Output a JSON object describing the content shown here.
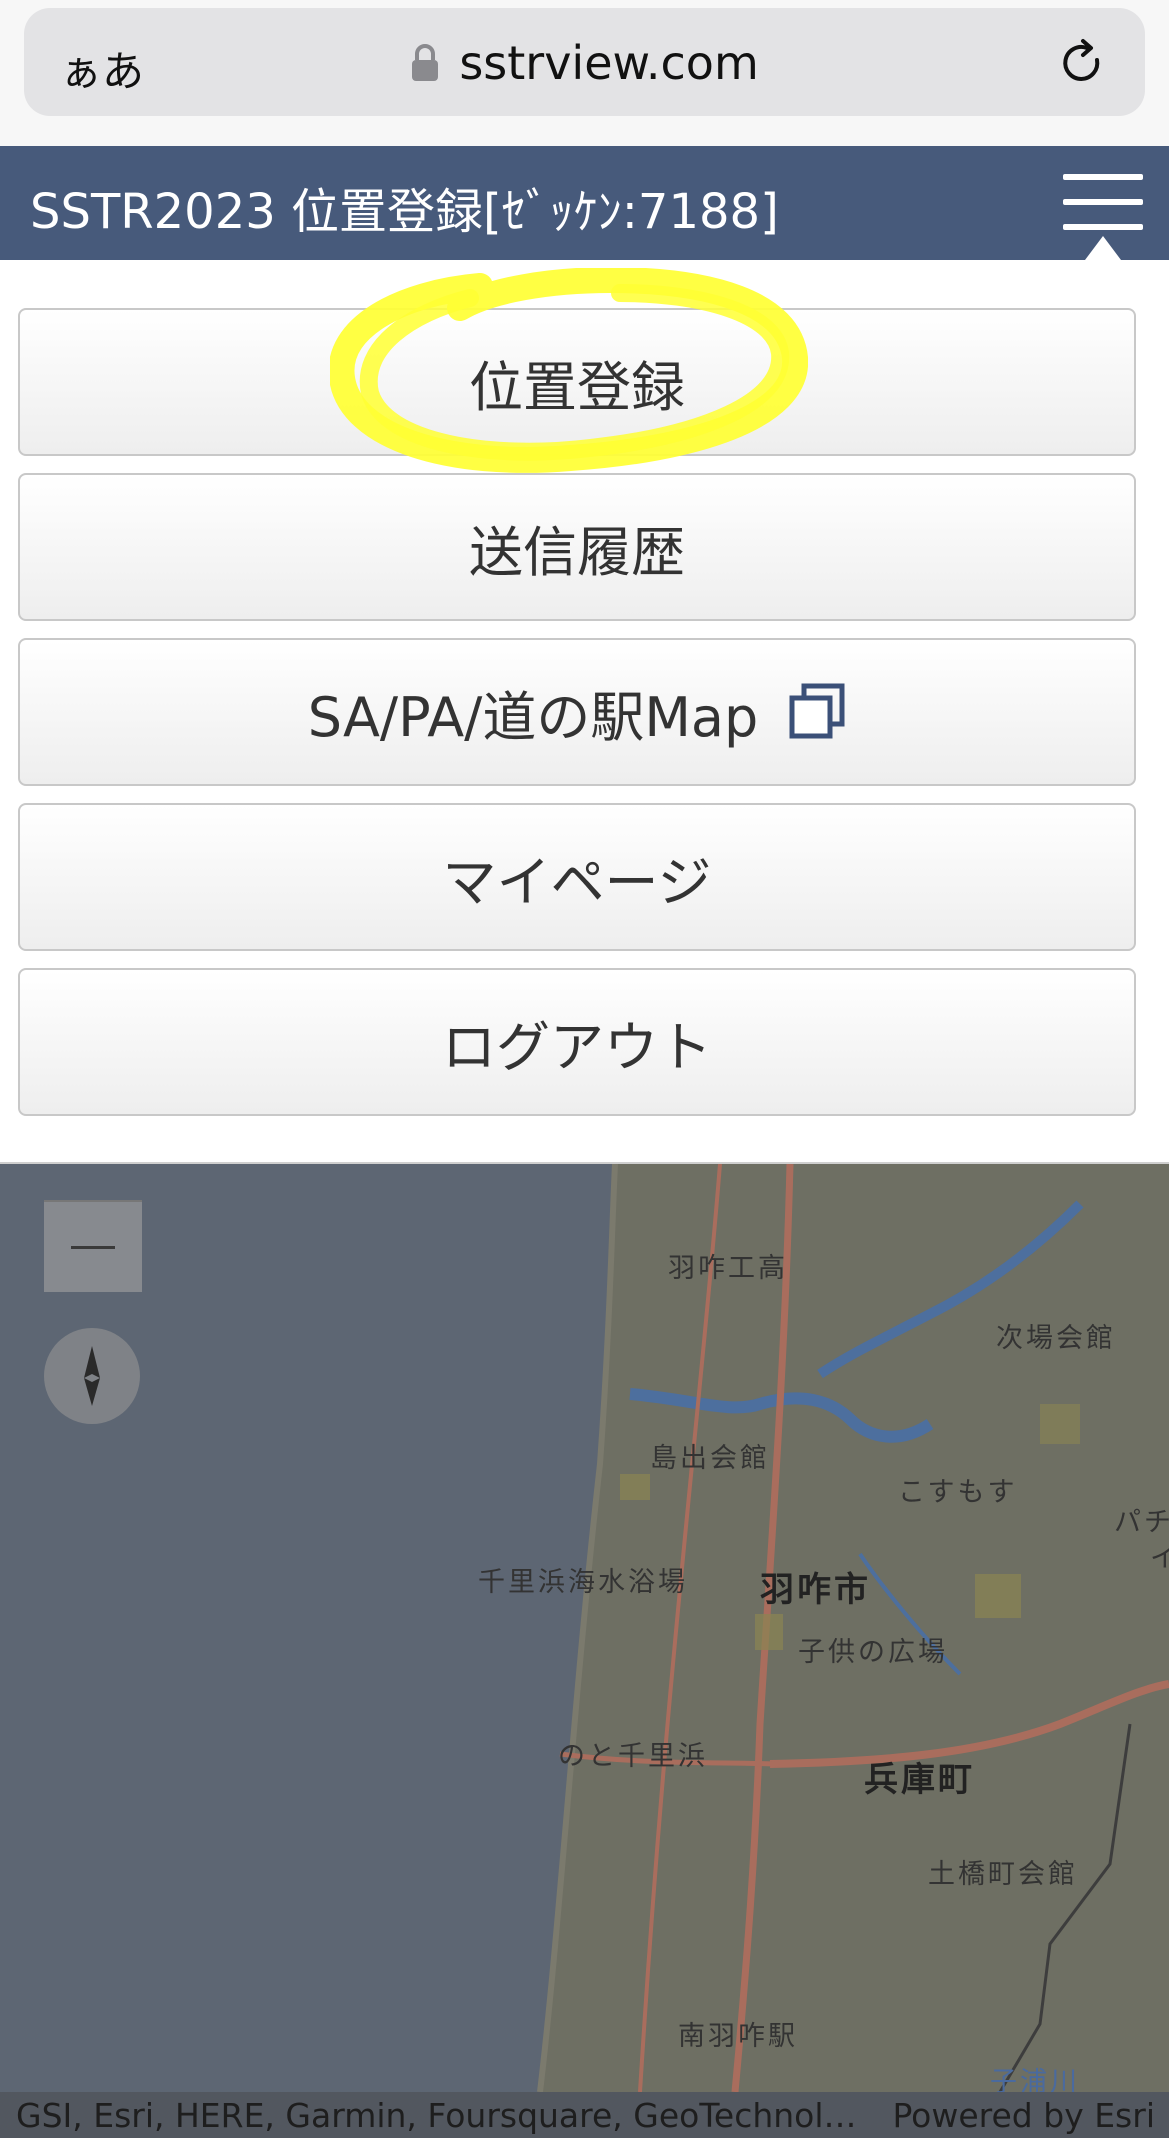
{
  "browser": {
    "text_size_button": "ぁあ",
    "url": "sstrview.com",
    "lock_icon": "lock-icon",
    "reload_icon": "reload-icon"
  },
  "header": {
    "title": "SSTR2023 位置登録[ｾﾞｯｹﾝ:7188]",
    "menu_icon": "hamburger-icon",
    "background": "#475a7b"
  },
  "menu": {
    "items": [
      {
        "label": "位置登録",
        "highlighted": true
      },
      {
        "label": "送信履歴"
      },
      {
        "label": "SA/PA/道の駅Map",
        "icon": "external-window-icon"
      },
      {
        "label": "マイページ"
      },
      {
        "label": "ログアウト"
      }
    ],
    "highlight_color": "#ffff33"
  },
  "map": {
    "labels": [
      {
        "text": "羽咋工高"
      },
      {
        "text": "次場会館"
      },
      {
        "text": "島出会館"
      },
      {
        "text": "こすもす"
      },
      {
        "text": "パチ"
      },
      {
        "text": "イ"
      },
      {
        "text": "千里浜海水浴場"
      },
      {
        "text": "羽咋市"
      },
      {
        "text": "子供の広場"
      },
      {
        "text": "のと千里浜"
      },
      {
        "text": "兵庫町"
      },
      {
        "text": "土橋町会館"
      },
      {
        "text": "南羽咋駅"
      },
      {
        "text": "子浦川"
      }
    ],
    "zoom_out_label": "—",
    "compass_icon": "compass-icon"
  },
  "attribution": {
    "sources": "GSI, Esri, HERE, Garmin, Foursquare, GeoTechnol…",
    "powered_by": "Powered by Esri"
  }
}
